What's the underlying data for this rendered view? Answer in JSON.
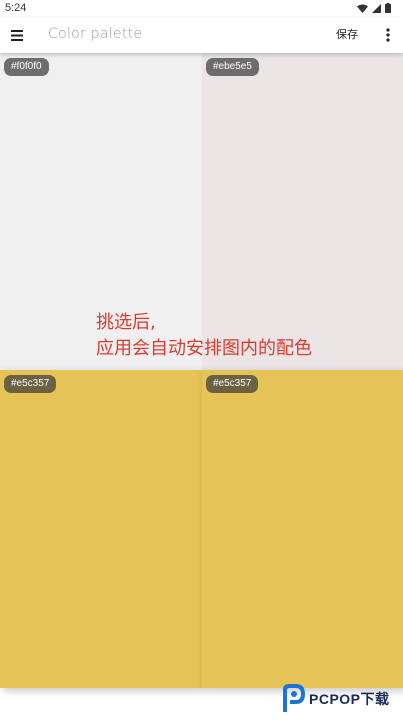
{
  "status_bar": {
    "time": "5:24"
  },
  "app_bar": {
    "title": "Color palette",
    "save_label": "保存"
  },
  "palette": {
    "swatches": [
      {
        "hex": "#f0f0f0",
        "color": "#f0f0f0"
      },
      {
        "hex": "#ebe5e5",
        "color": "#ebe5e5"
      },
      {
        "hex": "#e5c357",
        "color": "#e5c357"
      },
      {
        "hex": "#e5c357",
        "color": "#e5c357"
      }
    ]
  },
  "overlay": {
    "line1": "挑选后,",
    "line2": "应用会自动安排图内的配色"
  },
  "watermark": {
    "text": "PCPOP下载"
  }
}
